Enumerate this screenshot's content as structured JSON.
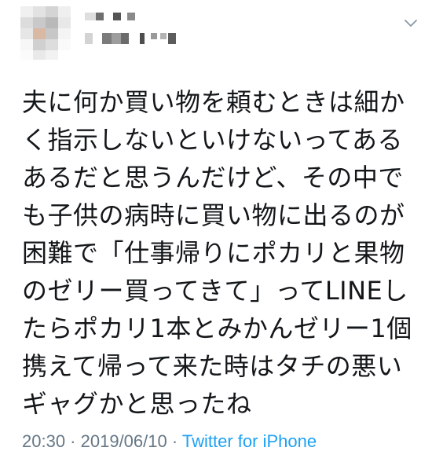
{
  "tweet": {
    "lines": [
      "夫に何か買い物を頼むときは細か",
      "く指示しないといけないってある",
      "あるだと思うんだけど、その中で",
      "も子供の病時に買い物に出るのが",
      "困難で「仕事帰りにポカリと果物",
      "のゼリー買ってきて」ってLINEし",
      "たらポカリ1本とみかんゼリー1個",
      "携えて帰って来た時はタチの悪い",
      "ギャグかと思ったね"
    ],
    "time": "20:30",
    "separator1": " · ",
    "date": "2019/06/10",
    "separator2": " · ",
    "source": "Twitter for iPhone"
  },
  "icons": {
    "menu": "chevron-down-icon"
  },
  "colors": {
    "text": "#14171a",
    "meta": "#657786",
    "link": "#1da1f2",
    "chevron": "#8899a6"
  }
}
